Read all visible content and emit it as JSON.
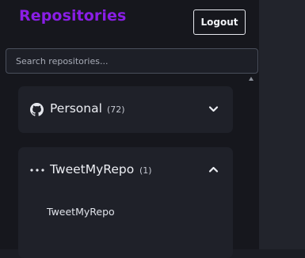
{
  "header": {
    "title": "Repositories",
    "logout_label": "Logout"
  },
  "search": {
    "placeholder": "Search repositories...",
    "value": ""
  },
  "groups": [
    {
      "name": "Personal",
      "count": "(72)",
      "icon": "github-icon",
      "expanded": false
    },
    {
      "name": "TweetMyRepo",
      "count": "(1)",
      "icon": "dots-icon",
      "expanded": true,
      "repos": [
        "TweetMyRepo"
      ]
    }
  ],
  "colors": {
    "accent": "#8a1ee6",
    "sidebar_bg": "#16171d",
    "card_bg": "#1f2129"
  }
}
